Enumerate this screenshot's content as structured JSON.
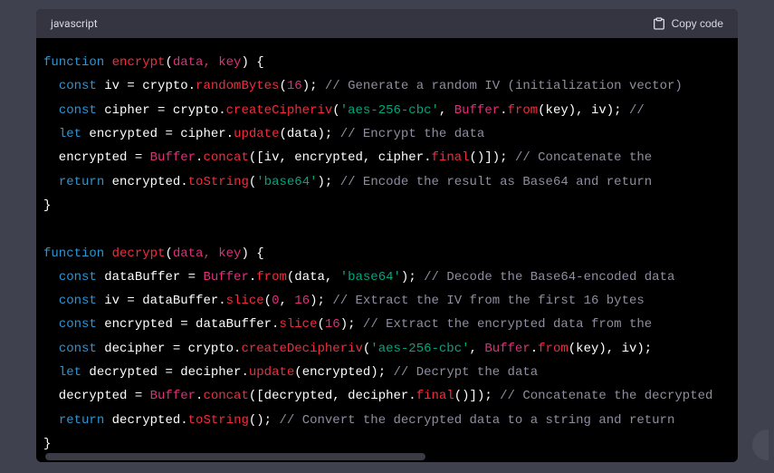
{
  "header": {
    "language": "javascript",
    "copy_label": "Copy code"
  },
  "code": {
    "tokens": [
      [
        [
          "kw",
          "function"
        ],
        [
          "plain",
          " "
        ],
        [
          "fn",
          "encrypt"
        ],
        [
          "plain",
          "("
        ],
        [
          "builtin",
          "data, key"
        ],
        [
          "plain",
          ") {"
        ]
      ],
      [
        [
          "plain",
          "  "
        ],
        [
          "kw",
          "const"
        ],
        [
          "plain",
          " iv = crypto."
        ],
        [
          "fn",
          "randomBytes"
        ],
        [
          "plain",
          "("
        ],
        [
          "num",
          "16"
        ],
        [
          "plain",
          "); "
        ],
        [
          "cmt",
          "// Generate a random IV (initialization vector)"
        ]
      ],
      [
        [
          "plain",
          "  "
        ],
        [
          "kw",
          "const"
        ],
        [
          "plain",
          " cipher = crypto."
        ],
        [
          "fn",
          "createCipheriv"
        ],
        [
          "plain",
          "("
        ],
        [
          "str",
          "'aes-256-cbc'"
        ],
        [
          "plain",
          ", "
        ],
        [
          "builtin",
          "Buffer"
        ],
        [
          "plain",
          "."
        ],
        [
          "fn",
          "from"
        ],
        [
          "plain",
          "(key), iv); "
        ],
        [
          "cmt",
          "// "
        ]
      ],
      [
        [
          "plain",
          "  "
        ],
        [
          "kw",
          "let"
        ],
        [
          "plain",
          " encrypted = cipher."
        ],
        [
          "fn",
          "update"
        ],
        [
          "plain",
          "(data); "
        ],
        [
          "cmt",
          "// Encrypt the data"
        ]
      ],
      [
        [
          "plain",
          "  encrypted = "
        ],
        [
          "builtin",
          "Buffer"
        ],
        [
          "plain",
          "."
        ],
        [
          "fn",
          "concat"
        ],
        [
          "plain",
          "([iv, encrypted, cipher."
        ],
        [
          "fn",
          "final"
        ],
        [
          "plain",
          "()]); "
        ],
        [
          "cmt",
          "// Concatenate the"
        ]
      ],
      [
        [
          "plain",
          "  "
        ],
        [
          "kw",
          "return"
        ],
        [
          "plain",
          " encrypted."
        ],
        [
          "fn",
          "toString"
        ],
        [
          "plain",
          "("
        ],
        [
          "str",
          "'base64'"
        ],
        [
          "plain",
          "); "
        ],
        [
          "cmt",
          "// Encode the result as Base64 and return"
        ]
      ],
      [
        [
          "plain",
          "}"
        ]
      ],
      [
        [
          "plain",
          ""
        ]
      ],
      [
        [
          "kw",
          "function"
        ],
        [
          "plain",
          " "
        ],
        [
          "fn",
          "decrypt"
        ],
        [
          "plain",
          "("
        ],
        [
          "builtin",
          "data, key"
        ],
        [
          "plain",
          ") {"
        ]
      ],
      [
        [
          "plain",
          "  "
        ],
        [
          "kw",
          "const"
        ],
        [
          "plain",
          " dataBuffer = "
        ],
        [
          "builtin",
          "Buffer"
        ],
        [
          "plain",
          "."
        ],
        [
          "fn",
          "from"
        ],
        [
          "plain",
          "(data, "
        ],
        [
          "str",
          "'base64'"
        ],
        [
          "plain",
          "); "
        ],
        [
          "cmt",
          "// Decode the Base64-encoded data"
        ]
      ],
      [
        [
          "plain",
          "  "
        ],
        [
          "kw",
          "const"
        ],
        [
          "plain",
          " iv = dataBuffer."
        ],
        [
          "fn",
          "slice"
        ],
        [
          "plain",
          "("
        ],
        [
          "num",
          "0"
        ],
        [
          "plain",
          ", "
        ],
        [
          "num",
          "16"
        ],
        [
          "plain",
          "); "
        ],
        [
          "cmt",
          "// Extract the IV from the first 16 bytes"
        ]
      ],
      [
        [
          "plain",
          "  "
        ],
        [
          "kw",
          "const"
        ],
        [
          "plain",
          " encrypted = dataBuffer."
        ],
        [
          "fn",
          "slice"
        ],
        [
          "plain",
          "("
        ],
        [
          "num",
          "16"
        ],
        [
          "plain",
          "); "
        ],
        [
          "cmt",
          "// Extract the encrypted data from the"
        ]
      ],
      [
        [
          "plain",
          "  "
        ],
        [
          "kw",
          "const"
        ],
        [
          "plain",
          " decipher = crypto."
        ],
        [
          "fn",
          "createDecipheriv"
        ],
        [
          "plain",
          "("
        ],
        [
          "str",
          "'aes-256-cbc'"
        ],
        [
          "plain",
          ", "
        ],
        [
          "builtin",
          "Buffer"
        ],
        [
          "plain",
          "."
        ],
        [
          "fn",
          "from"
        ],
        [
          "plain",
          "(key), iv);"
        ]
      ],
      [
        [
          "plain",
          "  "
        ],
        [
          "kw",
          "let"
        ],
        [
          "plain",
          " decrypted = decipher."
        ],
        [
          "fn",
          "update"
        ],
        [
          "plain",
          "(encrypted); "
        ],
        [
          "cmt",
          "// Decrypt the data"
        ]
      ],
      [
        [
          "plain",
          "  decrypted = "
        ],
        [
          "builtin",
          "Buffer"
        ],
        [
          "plain",
          "."
        ],
        [
          "fn",
          "concat"
        ],
        [
          "plain",
          "([decrypted, decipher."
        ],
        [
          "fn",
          "final"
        ],
        [
          "plain",
          "()]); "
        ],
        [
          "cmt",
          "// Concatenate the decrypted"
        ]
      ],
      [
        [
          "plain",
          "  "
        ],
        [
          "kw",
          "return"
        ],
        [
          "plain",
          " decrypted."
        ],
        [
          "fn",
          "toString"
        ],
        [
          "plain",
          "(); "
        ],
        [
          "cmt",
          "// Convert the decrypted data to a string and return"
        ]
      ],
      [
        [
          "plain",
          "}"
        ]
      ]
    ]
  }
}
